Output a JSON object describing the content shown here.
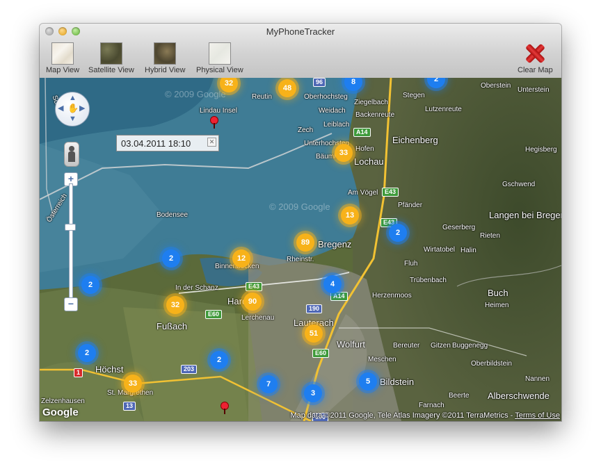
{
  "window": {
    "title": "MyPhoneTracker"
  },
  "toolbar": {
    "map_view": "Map View",
    "satellite_view": "Satellite View",
    "hybrid_view": "Hybrid View",
    "physical_view": "Physical View",
    "clear_map": "Clear Map"
  },
  "map": {
    "info_window_text": "03.04.2011 18:10",
    "watermark": "© 2009 Google",
    "logo": "Google",
    "attribution": "Map data ©2011 Google, Tele Atlas Imagery ©2011 TerraMetrics - ",
    "terms": "Terms of Use",
    "places": [
      "Lindau Insel",
      "Reutin",
      "Oberhochsteg",
      "Weidach",
      "Leiblach",
      "Zech",
      "Unterhochsteg",
      "Hofen",
      "Lochau",
      "Bäumle",
      "Am Vögel",
      "Eichenberg",
      "Pfänder",
      "Bodensee",
      "Bregenz",
      "Binnenbecken",
      "Rheinstr.",
      "Hard",
      "In der Schanz",
      "Lerchenau",
      "Lauterach",
      "Fußach",
      "Wolfurt",
      "Höchst",
      "St. Margrethen",
      "Zelzenhausen",
      "Stegen",
      "Lutzenreute",
      "Oberstein",
      "Unterstein",
      "Hegisberg",
      "Gschwend",
      "Langen bei Bregenz",
      "Geserberg",
      "Rieten",
      "Wirtatobel",
      "Halin",
      "Fluh",
      "Trübenbach",
      "Herzenmoos",
      "Buch",
      "Heimen",
      "Bereuter",
      "Gitzen",
      "Buggenegg",
      "Meschen",
      "Oberbildstein",
      "Bildstein",
      "Nannen",
      "Alberschwende",
      "Farnach",
      "Beerte",
      "Ziegelbach",
      "Backenreute",
      "Schweiz",
      "Österreich"
    ],
    "clusters": [
      {
        "n": "32",
        "c": "y"
      },
      {
        "n": "48",
        "c": "y"
      },
      {
        "n": "8",
        "c": "b"
      },
      {
        "n": "2",
        "c": "b"
      },
      {
        "n": "33",
        "c": "y"
      },
      {
        "n": "13",
        "c": "y"
      },
      {
        "n": "2",
        "c": "b"
      },
      {
        "n": "89",
        "c": "y"
      },
      {
        "n": "12",
        "c": "y"
      },
      {
        "n": "2",
        "c": "b"
      },
      {
        "n": "2",
        "c": "b"
      },
      {
        "n": "4",
        "c": "b"
      },
      {
        "n": "90",
        "c": "y"
      },
      {
        "n": "32",
        "c": "y"
      },
      {
        "n": "51",
        "c": "y"
      },
      {
        "n": "2",
        "c": "b"
      },
      {
        "n": "2",
        "c": "b"
      },
      {
        "n": "7",
        "c": "b"
      },
      {
        "n": "3",
        "c": "b"
      },
      {
        "n": "5",
        "c": "b"
      },
      {
        "n": "33",
        "c": "y"
      }
    ],
    "road_shields": [
      "96",
      "A14",
      "A14",
      "E43",
      "E43",
      "190",
      "E43",
      "E60",
      "E60",
      "203",
      "1",
      "13",
      "190"
    ]
  }
}
